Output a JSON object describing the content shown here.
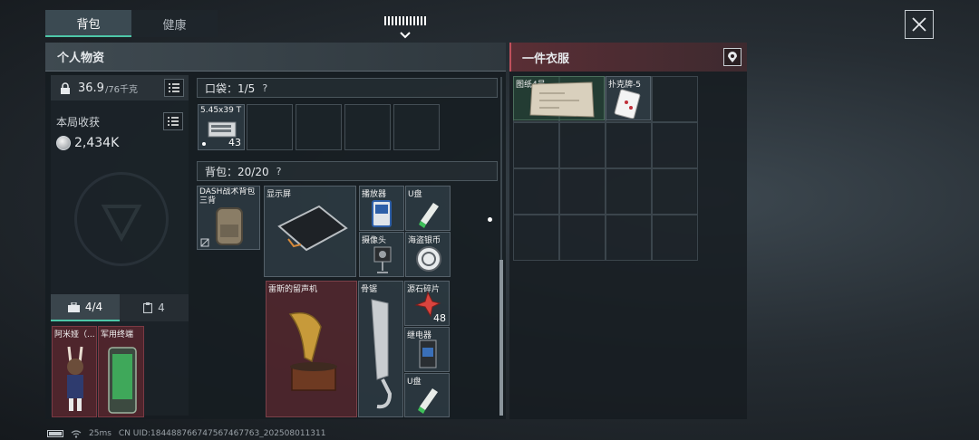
{
  "tabs": [
    {
      "label": "背包",
      "active": true
    },
    {
      "label": "健康",
      "active": false
    }
  ],
  "personal": {
    "title": "个人物资",
    "weight_value": "36.9",
    "weight_unit": "/76千克",
    "income_label": "本局收获",
    "income_value": "2,434K",
    "subtabs": [
      {
        "label": "4/4",
        "icon": "toolbox-icon",
        "active": true
      },
      {
        "label": "4",
        "icon": "clipboard-icon",
        "active": false
      }
    ],
    "characters": [
      {
        "label": "阿米娅（..."
      },
      {
        "label": "军用终端"
      }
    ]
  },
  "pocket": {
    "label": "口袋：1/5",
    "help": "?",
    "items": [
      {
        "label": "5.45x39 T",
        "count": "43"
      }
    ]
  },
  "backpack": {
    "label": "背包：20/20",
    "help": "?",
    "items": [
      {
        "label": "DASH战术背包 三背",
        "icon": "backpack-icon"
      },
      {
        "label": "显示屏",
        "icon": "monitor-icon"
      },
      {
        "label": "播放器",
        "icon": "player-icon"
      },
      {
        "label": "U盘",
        "icon": "usb-icon"
      },
      {
        "label": "摄像头",
        "icon": "camera-icon"
      },
      {
        "label": "海盗银币",
        "icon": "silver-coin-icon"
      },
      {
        "label": "雷斯的留声机",
        "icon": "gramophone-icon"
      },
      {
        "label": "骨锯",
        "icon": "bone-saw-icon"
      },
      {
        "label": "源石碎片",
        "icon": "originium-shard-icon",
        "count": "48"
      },
      {
        "label": "继电器",
        "icon": "relay-icon"
      },
      {
        "label": "U盘",
        "icon": "usb-icon"
      }
    ]
  },
  "clothing": {
    "title": "一件衣服",
    "items": [
      {
        "label": "图纸4号",
        "icon": "blueprint-icon"
      },
      {
        "label": "扑克牌-5",
        "icon": "playing-card-icon"
      }
    ]
  },
  "status": {
    "ping": "25ms",
    "uid": "CN UID:1844887667475674677​63_202508011311"
  },
  "colors": {
    "accent": "#4ec7a8",
    "red_cell": "#6e2c34",
    "blue_cell": "#3a4a56"
  }
}
